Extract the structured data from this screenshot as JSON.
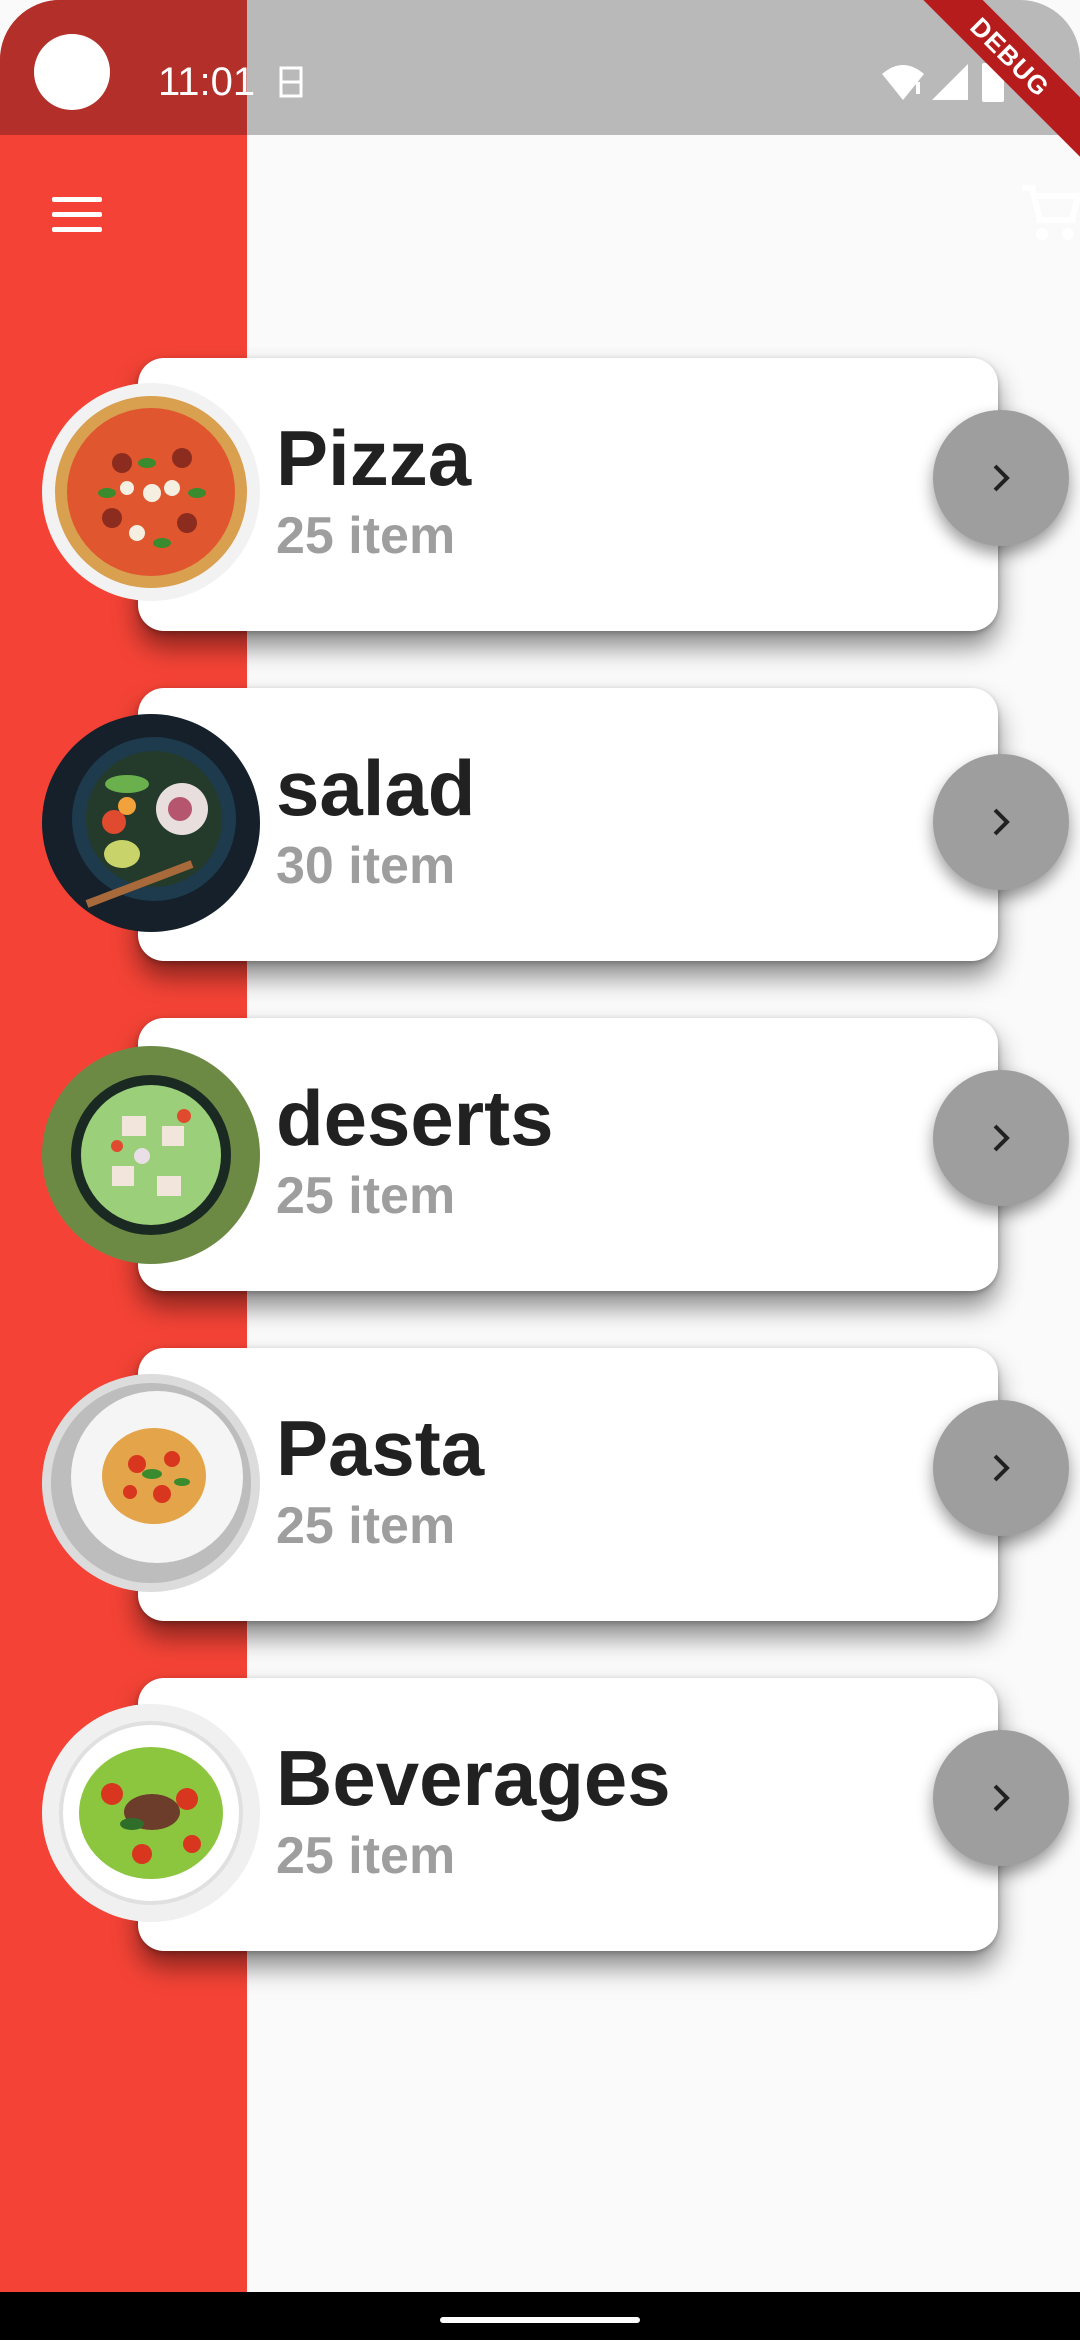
{
  "status_bar": {
    "time": "11:01",
    "debug_banner": "DEBUG"
  },
  "app_bar": {
    "menu_icon": "menu-icon",
    "cart_icon": "shopping-cart-icon"
  },
  "categories": [
    {
      "title": "Pizza",
      "count": "25 item",
      "image": "pizza-thumbnail"
    },
    {
      "title": "salad",
      "count": "30 item",
      "image": "salad-bowl-thumbnail"
    },
    {
      "title": "deserts",
      "count": "25 item",
      "image": "dessert-salad-thumbnail"
    },
    {
      "title": "Pasta",
      "count": "25 item",
      "image": "pasta-plate-thumbnail"
    },
    {
      "title": "Beverages",
      "count": "25 item",
      "image": "garden-salad-thumbnail"
    }
  ],
  "colors": {
    "accent_red": "#f44336",
    "arrow_button": "#9e9e9e",
    "title_text": "#212121",
    "count_text": "#9e9e9e"
  }
}
